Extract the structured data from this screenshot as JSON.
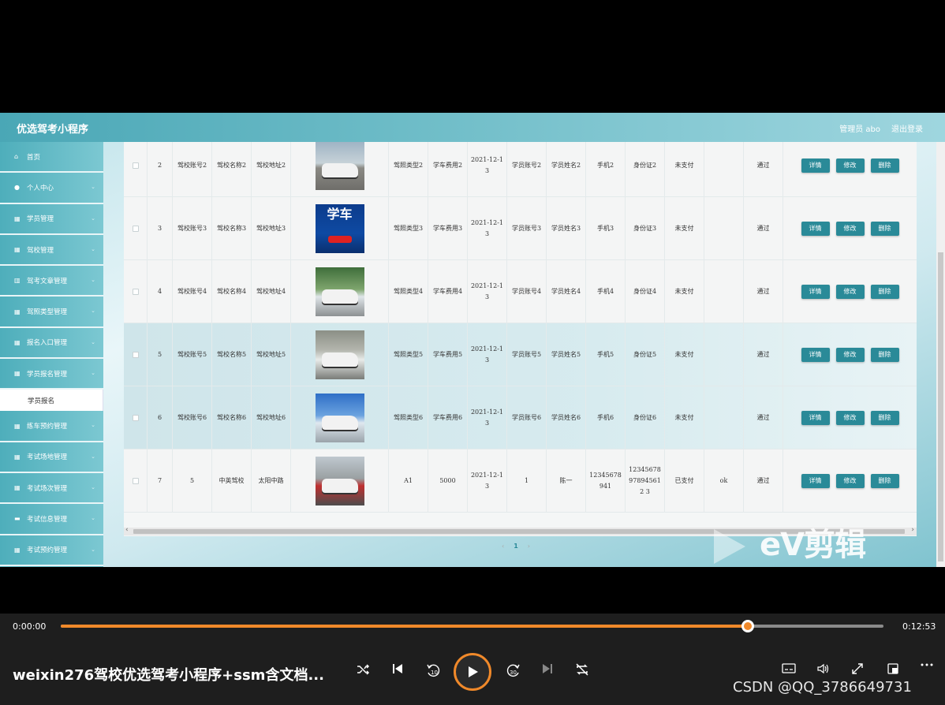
{
  "app": {
    "title": "优选驾考小程序",
    "admin_label": "管理员 abo",
    "logout_label": "退出登录"
  },
  "sidebar": {
    "items": [
      {
        "label": "首页",
        "icon": "home-icon"
      },
      {
        "label": "个人中心",
        "icon": "user-icon"
      },
      {
        "label": "学员管理",
        "icon": "grid-icon"
      },
      {
        "label": "驾校管理",
        "icon": "grid-icon"
      },
      {
        "label": "驾考文章管理",
        "icon": "chart-icon"
      },
      {
        "label": "驾照类型管理",
        "icon": "grid-icon"
      },
      {
        "label": "报名入口管理",
        "icon": "grid-icon"
      },
      {
        "label": "学员报名管理",
        "icon": "grid-icon"
      },
      {
        "label": "练车预约管理",
        "icon": "grid-icon"
      },
      {
        "label": "考试场地管理",
        "icon": "grid-icon"
      },
      {
        "label": "考试场次管理",
        "icon": "grid-icon"
      },
      {
        "label": "考试信息管理",
        "icon": "id-card-icon"
      },
      {
        "label": "考试预约管理",
        "icon": "grid-icon"
      }
    ],
    "sub_item": "学员报名"
  },
  "table": {
    "buttons": {
      "detail": "详情",
      "edit": "修改",
      "delete": "删除"
    },
    "rows": [
      {
        "idx": "2",
        "acct": "驾校账号2",
        "name": "驾校名称2",
        "addr": "驾校地址2",
        "type": "驾照类型2",
        "fee": "学车费用2",
        "date": "2021-12-13",
        "stu_acct": "学员账号2",
        "stu_name": "学员姓名2",
        "phone": "手机2",
        "idcard": "身份证2",
        "pay": "未支付",
        "reply": "",
        "status": "通过"
      },
      {
        "idx": "3",
        "acct": "驾校账号3",
        "name": "驾校名称3",
        "addr": "驾校地址3",
        "type": "驾照类型3",
        "fee": "学车费用3",
        "date": "2021-12-13",
        "stu_acct": "学员账号3",
        "stu_name": "学员姓名3",
        "phone": "手机3",
        "idcard": "身份证3",
        "pay": "未支付",
        "reply": "",
        "status": "通过"
      },
      {
        "idx": "4",
        "acct": "驾校账号4",
        "name": "驾校名称4",
        "addr": "驾校地址4",
        "type": "驾照类型4",
        "fee": "学车费用4",
        "date": "2021-12-13",
        "stu_acct": "学员账号4",
        "stu_name": "学员姓名4",
        "phone": "手机4",
        "idcard": "身份证4",
        "pay": "未支付",
        "reply": "",
        "status": "通过"
      },
      {
        "idx": "5",
        "acct": "驾校账号5",
        "name": "驾校名称5",
        "addr": "驾校地址5",
        "type": "驾照类型5",
        "fee": "学车费用5",
        "date": "2021-12-13",
        "stu_acct": "学员账号5",
        "stu_name": "学员姓名5",
        "phone": "手机5",
        "idcard": "身份证5",
        "pay": "未支付",
        "reply": "",
        "status": "通过"
      },
      {
        "idx": "6",
        "acct": "驾校账号6",
        "name": "驾校名称6",
        "addr": "驾校地址6",
        "type": "驾照类型6",
        "fee": "学车费用6",
        "date": "2021-12-13",
        "stu_acct": "学员账号6",
        "stu_name": "学员姓名6",
        "phone": "手机6",
        "idcard": "身份证6",
        "pay": "未支付",
        "reply": "",
        "status": "通过"
      },
      {
        "idx": "7",
        "acct": "5",
        "name": "中英驾校",
        "addr": "太阳中路",
        "type": "A1",
        "fee": "5000",
        "date": "2021-12-13",
        "stu_acct": "1",
        "stu_name": "陈一",
        "phone": "12345678941",
        "idcard": "12345678978945612 3",
        "pay": "已支付",
        "reply": "ok",
        "status": "通过"
      }
    ],
    "thumb_text_row3": "学车"
  },
  "pager": {
    "prev": "‹",
    "page": "1",
    "next": "›"
  },
  "watermark": "eV剪辑",
  "player": {
    "time_current": "0:00:00",
    "time_total": "0:12:53",
    "progress": 0.835,
    "title": "weixin276驾校优选驾考小程序+ssm含文档...",
    "rewind_label": "10",
    "forward_label": "30",
    "credit": "CSDN @QQ_3786649731",
    "accent": "#f0892a"
  }
}
